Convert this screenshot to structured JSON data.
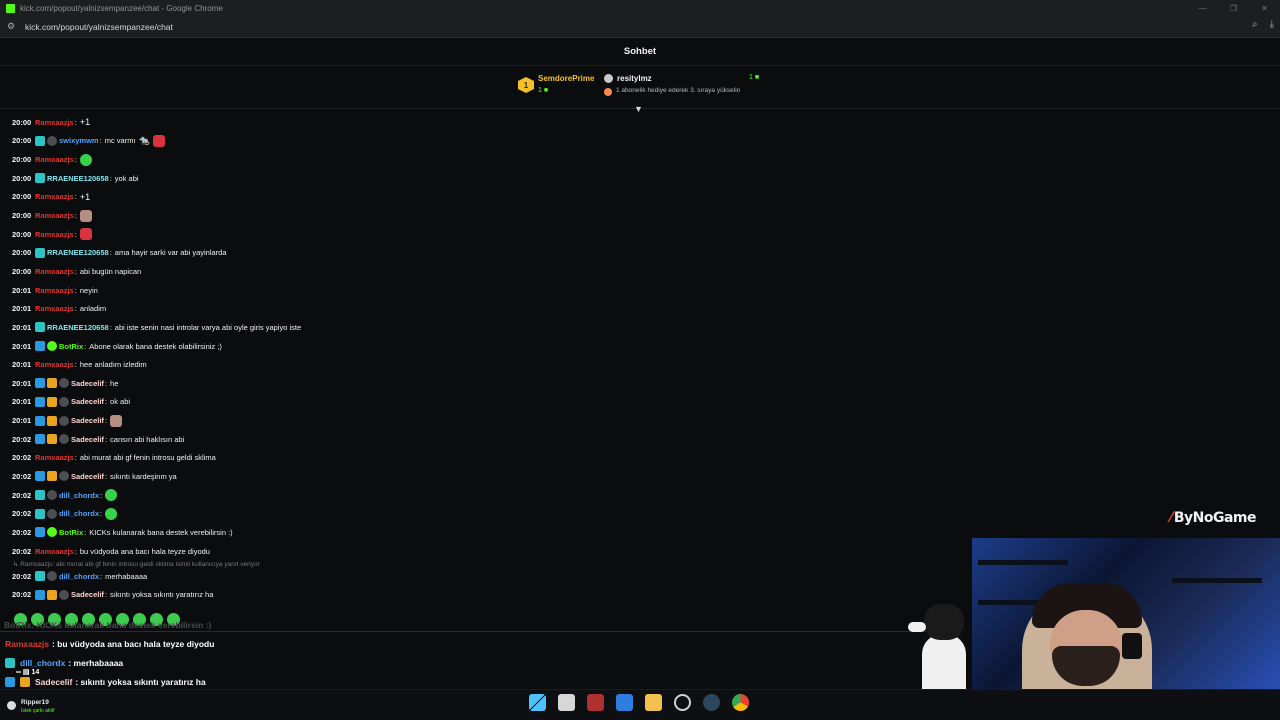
{
  "window": {
    "title": "kick.com/popout/yalnizsempanzee/chat - Google Chrome",
    "url": "kick.com/popout/yalnizsempanzee/chat",
    "controls": [
      "—",
      "❐",
      "✕"
    ]
  },
  "chat": {
    "title": "Sohbet",
    "pinned": {
      "rank": "1",
      "gifter_name": "SemdorePrime",
      "gifter_count": "1",
      "leader_name": "resitylmz",
      "leader_count": "1",
      "hint": "1 abonelik hediye ederek 3. sıraya yükselin"
    },
    "messages": [
      {
        "time": "20:00",
        "user": "Ramxaazjs",
        "color": "u-red",
        "badges": [],
        "text": "",
        "emotes": [
          "glyph:+1"
        ]
      },
      {
        "time": "20:00",
        "user": "swixymwm",
        "color": "u-blue",
        "badges": [
          "teal",
          "gray"
        ],
        "text": "mc varmı",
        "emotes": [
          "glyph:🐀",
          "red"
        ]
      },
      {
        "time": "20:00",
        "user": "Ramxaazjs",
        "color": "u-red",
        "badges": [],
        "text": "",
        "emotes": [
          "green"
        ]
      },
      {
        "time": "20:00",
        "user": "RRAENEE120658",
        "color": "u-teal",
        "badges": [
          "teal"
        ],
        "text": "yok abi",
        "emotes": []
      },
      {
        "time": "20:00",
        "user": "Ramxaazjs",
        "color": "u-red",
        "badges": [],
        "text": "",
        "emotes": [
          "glyph:+1"
        ]
      },
      {
        "time": "20:00",
        "user": "Ramxaazjs",
        "color": "u-red",
        "badges": [],
        "text": "",
        "emotes": [
          "face"
        ]
      },
      {
        "time": "20:00",
        "user": "Ramxaazjs",
        "color": "u-red",
        "badges": [],
        "text": "",
        "emotes": [
          "red"
        ]
      },
      {
        "time": "20:00",
        "user": "RRAENEE120658",
        "color": "u-teal",
        "badges": [
          "teal"
        ],
        "text": "ama hayir sarki var abi yayinlarda",
        "emotes": []
      },
      {
        "time": "20:00",
        "user": "Ramxaazjs",
        "color": "u-red",
        "badges": [],
        "text": "abi bugün napican",
        "emotes": []
      },
      {
        "time": "20:01",
        "user": "Ramxaazjs",
        "color": "u-red",
        "badges": [],
        "text": "neyin",
        "emotes": []
      },
      {
        "time": "20:01",
        "user": "Ramxaazjs",
        "color": "u-red",
        "badges": [],
        "text": "anladim",
        "emotes": []
      },
      {
        "time": "20:01",
        "user": "RRAENEE120658",
        "color": "u-teal",
        "badges": [
          "teal"
        ],
        "text": "abi iste senin nasi introlar varya abi oyle giris yapiyo iste",
        "emotes": []
      },
      {
        "time": "20:01",
        "user": "BotRix",
        "color": "u-green",
        "badges": [
          "blue",
          "bot"
        ],
        "text": "Abone olarak bana destek olabilirsiniz ;)",
        "emotes": []
      },
      {
        "time": "20:01",
        "user": "Ramxaazjs",
        "color": "u-red",
        "badges": [],
        "text": "hee anladım izledim",
        "emotes": []
      },
      {
        "time": "20:01",
        "user": "Sadecelif",
        "color": "u-pink",
        "badges": [
          "blue",
          "gold",
          "gray"
        ],
        "text": "he",
        "emotes": []
      },
      {
        "time": "20:01",
        "user": "Sadecelif",
        "color": "u-pink",
        "badges": [
          "blue",
          "gold",
          "gray"
        ],
        "text": "ok abi",
        "emotes": []
      },
      {
        "time": "20:01",
        "user": "Sadecelif",
        "color": "u-pink",
        "badges": [
          "blue",
          "gold",
          "gray"
        ],
        "text": "",
        "emotes": [
          "face"
        ]
      },
      {
        "time": "20:02",
        "user": "Sadecelif",
        "color": "u-pink",
        "badges": [
          "blue",
          "gold",
          "gray"
        ],
        "text": "cansın abi haklısın abi",
        "emotes": []
      },
      {
        "time": "20:02",
        "user": "Ramxaazjs",
        "color": "u-red",
        "badges": [],
        "text": "abi murat abi gf fenin introsu geldi sklima",
        "emotes": []
      },
      {
        "time": "20:02",
        "user": "Sadecelif",
        "color": "u-pink",
        "badges": [
          "blue",
          "gold",
          "gray"
        ],
        "text": "sıkıntı kardeşinm ya",
        "emotes": []
      },
      {
        "time": "20:02",
        "user": "dill_chordx",
        "color": "u-blue",
        "badges": [
          "teal",
          "gray"
        ],
        "text": "",
        "emotes": [
          "green"
        ]
      },
      {
        "time": "20:02",
        "user": "dill_chordx",
        "color": "u-blue",
        "badges": [
          "teal",
          "gray"
        ],
        "text": "",
        "emotes": [
          "green"
        ]
      },
      {
        "time": "20:02",
        "user": "BotRix",
        "color": "u-green",
        "badges": [
          "blue",
          "bot"
        ],
        "text": "KICKs kulanarak bana destek verebilirsin :)",
        "emotes": []
      },
      {
        "time": "20:02",
        "user": "Ramxaazjs",
        "color": "u-red",
        "badges": [],
        "text": "bu vüdyoda ana bacı hala teyze diyodu",
        "emotes": []
      }
    ],
    "reply_hint": "↳ Ramxaazjs: abi murat abi gf fenin introsu geldi sklima isimli kullanıcıya yanıt veriyor",
    "last_messages": [
      {
        "time": "20:02",
        "user": "dill_chordx",
        "color": "u-blue",
        "badges": [
          "teal",
          "gray"
        ],
        "text": "merhabaaaa"
      },
      {
        "time": "20:02",
        "user": "Sadecelif",
        "color": "u-pink",
        "badges": [
          "blue",
          "gold",
          "gray"
        ],
        "text": "sıkıntı yoksa sıkıntı yaratırız ha"
      }
    ]
  },
  "overlay": {
    "ghost": "BotRix: KICKs kulanarak bana destek verebilirsin :)",
    "lines": [
      {
        "user": "Ramxaazjs",
        "text": ": bu vüdyoda ana bacı hala teyze diyodu",
        "color": "u-red"
      },
      {
        "user": "dill_chordx",
        "text": ": merhabaaaa",
        "color": "u-blue"
      },
      {
        "user": "Sadecelif",
        "text": ": sıkıntı yoksa sıkıntı yaratırız ha",
        "color": "u-pink"
      }
    ],
    "viewer_stats": "∞   ▤ 14"
  },
  "brand": "ByNoGame",
  "taskbar": {
    "user": "Ripper19",
    "status": "İstek şarkı aktif",
    "icons": [
      "windows-start",
      "file-explorer-app",
      "pdf-app",
      "store-app",
      "folder-app",
      "ring-app",
      "steam-app",
      "chrome-app"
    ]
  },
  "colors": {
    "accent": "#53fc18",
    "background": "#0b0c0d",
    "red_user": "#e0352f",
    "gold": "#f5c028"
  }
}
